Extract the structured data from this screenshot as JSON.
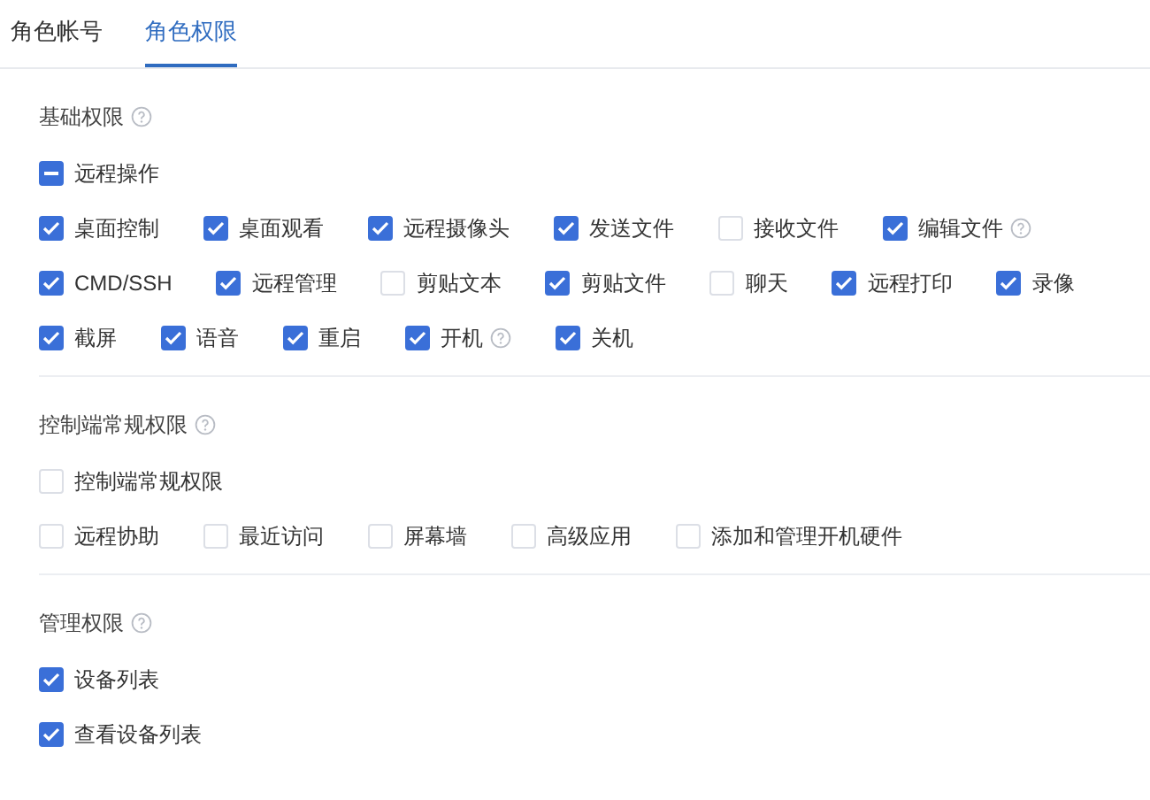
{
  "tabs": [
    {
      "label": "角色帐号",
      "selected": false
    },
    {
      "label": "角色权限",
      "selected": true
    }
  ],
  "sections": [
    {
      "title": "基础权限",
      "help": true,
      "group": {
        "label": "远程操作",
        "indeterminate": true
      },
      "lines": [
        {
          "items": [
            {
              "label": "桌面控制",
              "checked": true,
              "help": false
            },
            {
              "label": "桌面观看",
              "checked": true,
              "help": false
            },
            {
              "label": "远程摄像头",
              "checked": true,
              "help": false
            },
            {
              "label": "发送文件",
              "checked": true,
              "help": false
            },
            {
              "label": "接收文件",
              "checked": false,
              "help": false
            },
            {
              "label": "编辑文件",
              "checked": true,
              "help": true
            }
          ]
        },
        {
          "items": [
            {
              "label": "CMD/SSH",
              "checked": true,
              "help": false
            },
            {
              "label": "远程管理",
              "checked": true,
              "help": false
            },
            {
              "label": "剪贴文本",
              "checked": false,
              "help": false
            },
            {
              "label": "剪贴文件",
              "checked": true,
              "help": false
            },
            {
              "label": "聊天",
              "checked": false,
              "help": false
            },
            {
              "label": "远程打印",
              "checked": true,
              "help": false
            },
            {
              "label": "录像",
              "checked": true,
              "help": false
            }
          ]
        },
        {
          "items": [
            {
              "label": "截屏",
              "checked": true,
              "help": false
            },
            {
              "label": "语音",
              "checked": true,
              "help": false
            },
            {
              "label": "重启",
              "checked": true,
              "help": false
            },
            {
              "label": "开机",
              "checked": true,
              "help": true
            },
            {
              "label": "关机",
              "checked": true,
              "help": false
            }
          ]
        }
      ]
    },
    {
      "title": "控制端常规权限",
      "help": true,
      "group": {
        "label": "控制端常规权限",
        "checked": false
      },
      "lines": [
        {
          "items": [
            {
              "label": "远程协助",
              "checked": false,
              "help": false
            },
            {
              "label": "最近访问",
              "checked": false,
              "help": false
            },
            {
              "label": "屏幕墙",
              "checked": false,
              "help": false
            },
            {
              "label": "高级应用",
              "checked": false,
              "help": false
            },
            {
              "label": "添加和管理开机硬件",
              "checked": false,
              "help": false
            }
          ]
        }
      ]
    },
    {
      "title": "管理权限",
      "help": true,
      "group": {
        "label": "设备列表",
        "checked": true
      },
      "lines": [
        {
          "items": [
            {
              "label": "查看设备列表",
              "checked": true,
              "help": false
            }
          ]
        }
      ]
    }
  ]
}
